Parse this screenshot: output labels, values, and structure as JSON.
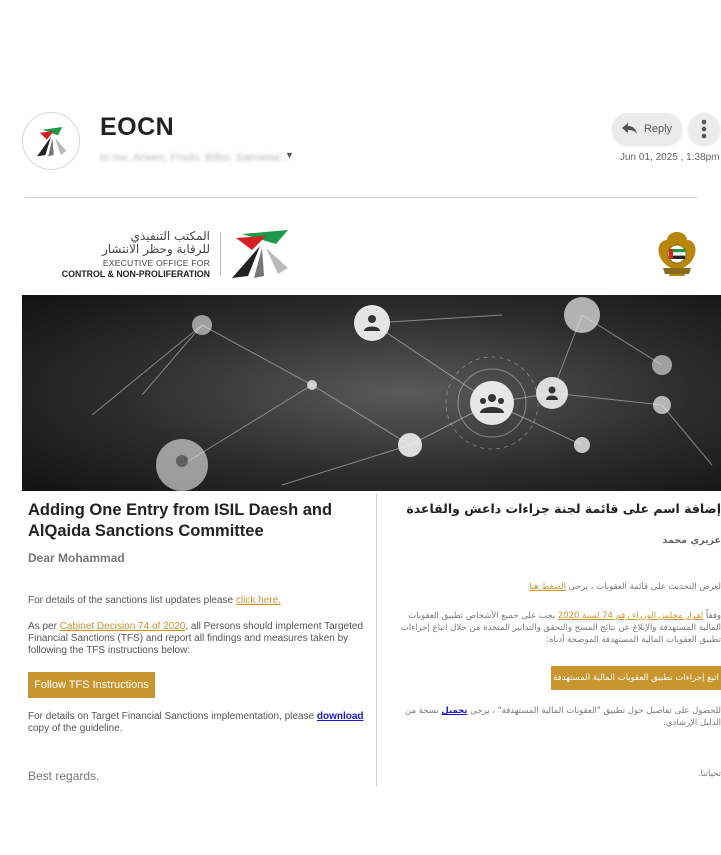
{
  "header": {
    "sender_name": "EOCN",
    "recipients": "to me, Arwen, Frodo, Bilbo, Samwise...",
    "reply_label": "Reply",
    "date": "Jun 01, 2025 , 1:38pm"
  },
  "brand": {
    "arabic_line1": "المكتب التنفيذي",
    "arabic_line2": "للرقابة وحظر الانتشار",
    "english_line1": "EXECUTIVE OFFICE FOR",
    "english_line2": "CONTROL & NON-PROLIFERATION"
  },
  "english": {
    "title": "Adding One Entry from ISIL Daesh and AlQaida Sanctions Committee",
    "greeting": "Dear Mohammad",
    "p1_prefix": "For details of the sanctions list updates please ",
    "p1_link": "click here.",
    "p2_prefix": "As per ",
    "p2_link": "Cabinet Decision 74 of 2020",
    "p2_suffix": ", all Persons should implement Targeted Financial Sanctions (TFS) and report all findings and measures taken by following the TFS instructions below:",
    "button": "Follow TFS Instructions",
    "p3_prefix": "For details on Target Financial Sanctions implementation, please ",
    "p3_link": "download",
    "p3_suffix": " copy of the guideline.",
    "closing": "Best regards."
  },
  "arabic": {
    "title": "إضافة اسم على قائمة لجنة جزاءات داعش والقاعدة",
    "greeting": "عزيزي محمد",
    "p1_prefix": "لعرض التحديث على قائمة العقوبات ، يرجى ",
    "p1_link": "الضغط هنا",
    "p2_prefix": "وفقاً ",
    "p2_link": "لقرار مجلس الوزراء رقم 74 لسنة 2020",
    "p2_suffix": " يجب على جميع الأشخاص تطبيق العقوبات المالية المستهدفة والإبلاغ عن نتائج المسح والتحقق والتدابير المتخذة من خلال اتباع إجراءات تطبيق العقوبات المالية المستهدفة الموضحة أدناه:",
    "button": "اتبع إجراءات تطبيق العقوبات المالية المستهدفة",
    "p3_prefix": "للحصول على تفاصيل حول تطبيق \"العقوبات المالية المستهدفة\" ، يرجى ",
    "p3_link": "تحميل",
    "p3_suffix": " نسخة من الدليل الإرشادي.",
    "closing": "تحياتنا."
  },
  "colors": {
    "accent_gold": "#c9952e",
    "link_blue": "#1a1acd",
    "logo_green": "#1a9a49",
    "logo_red": "#d71f26"
  }
}
